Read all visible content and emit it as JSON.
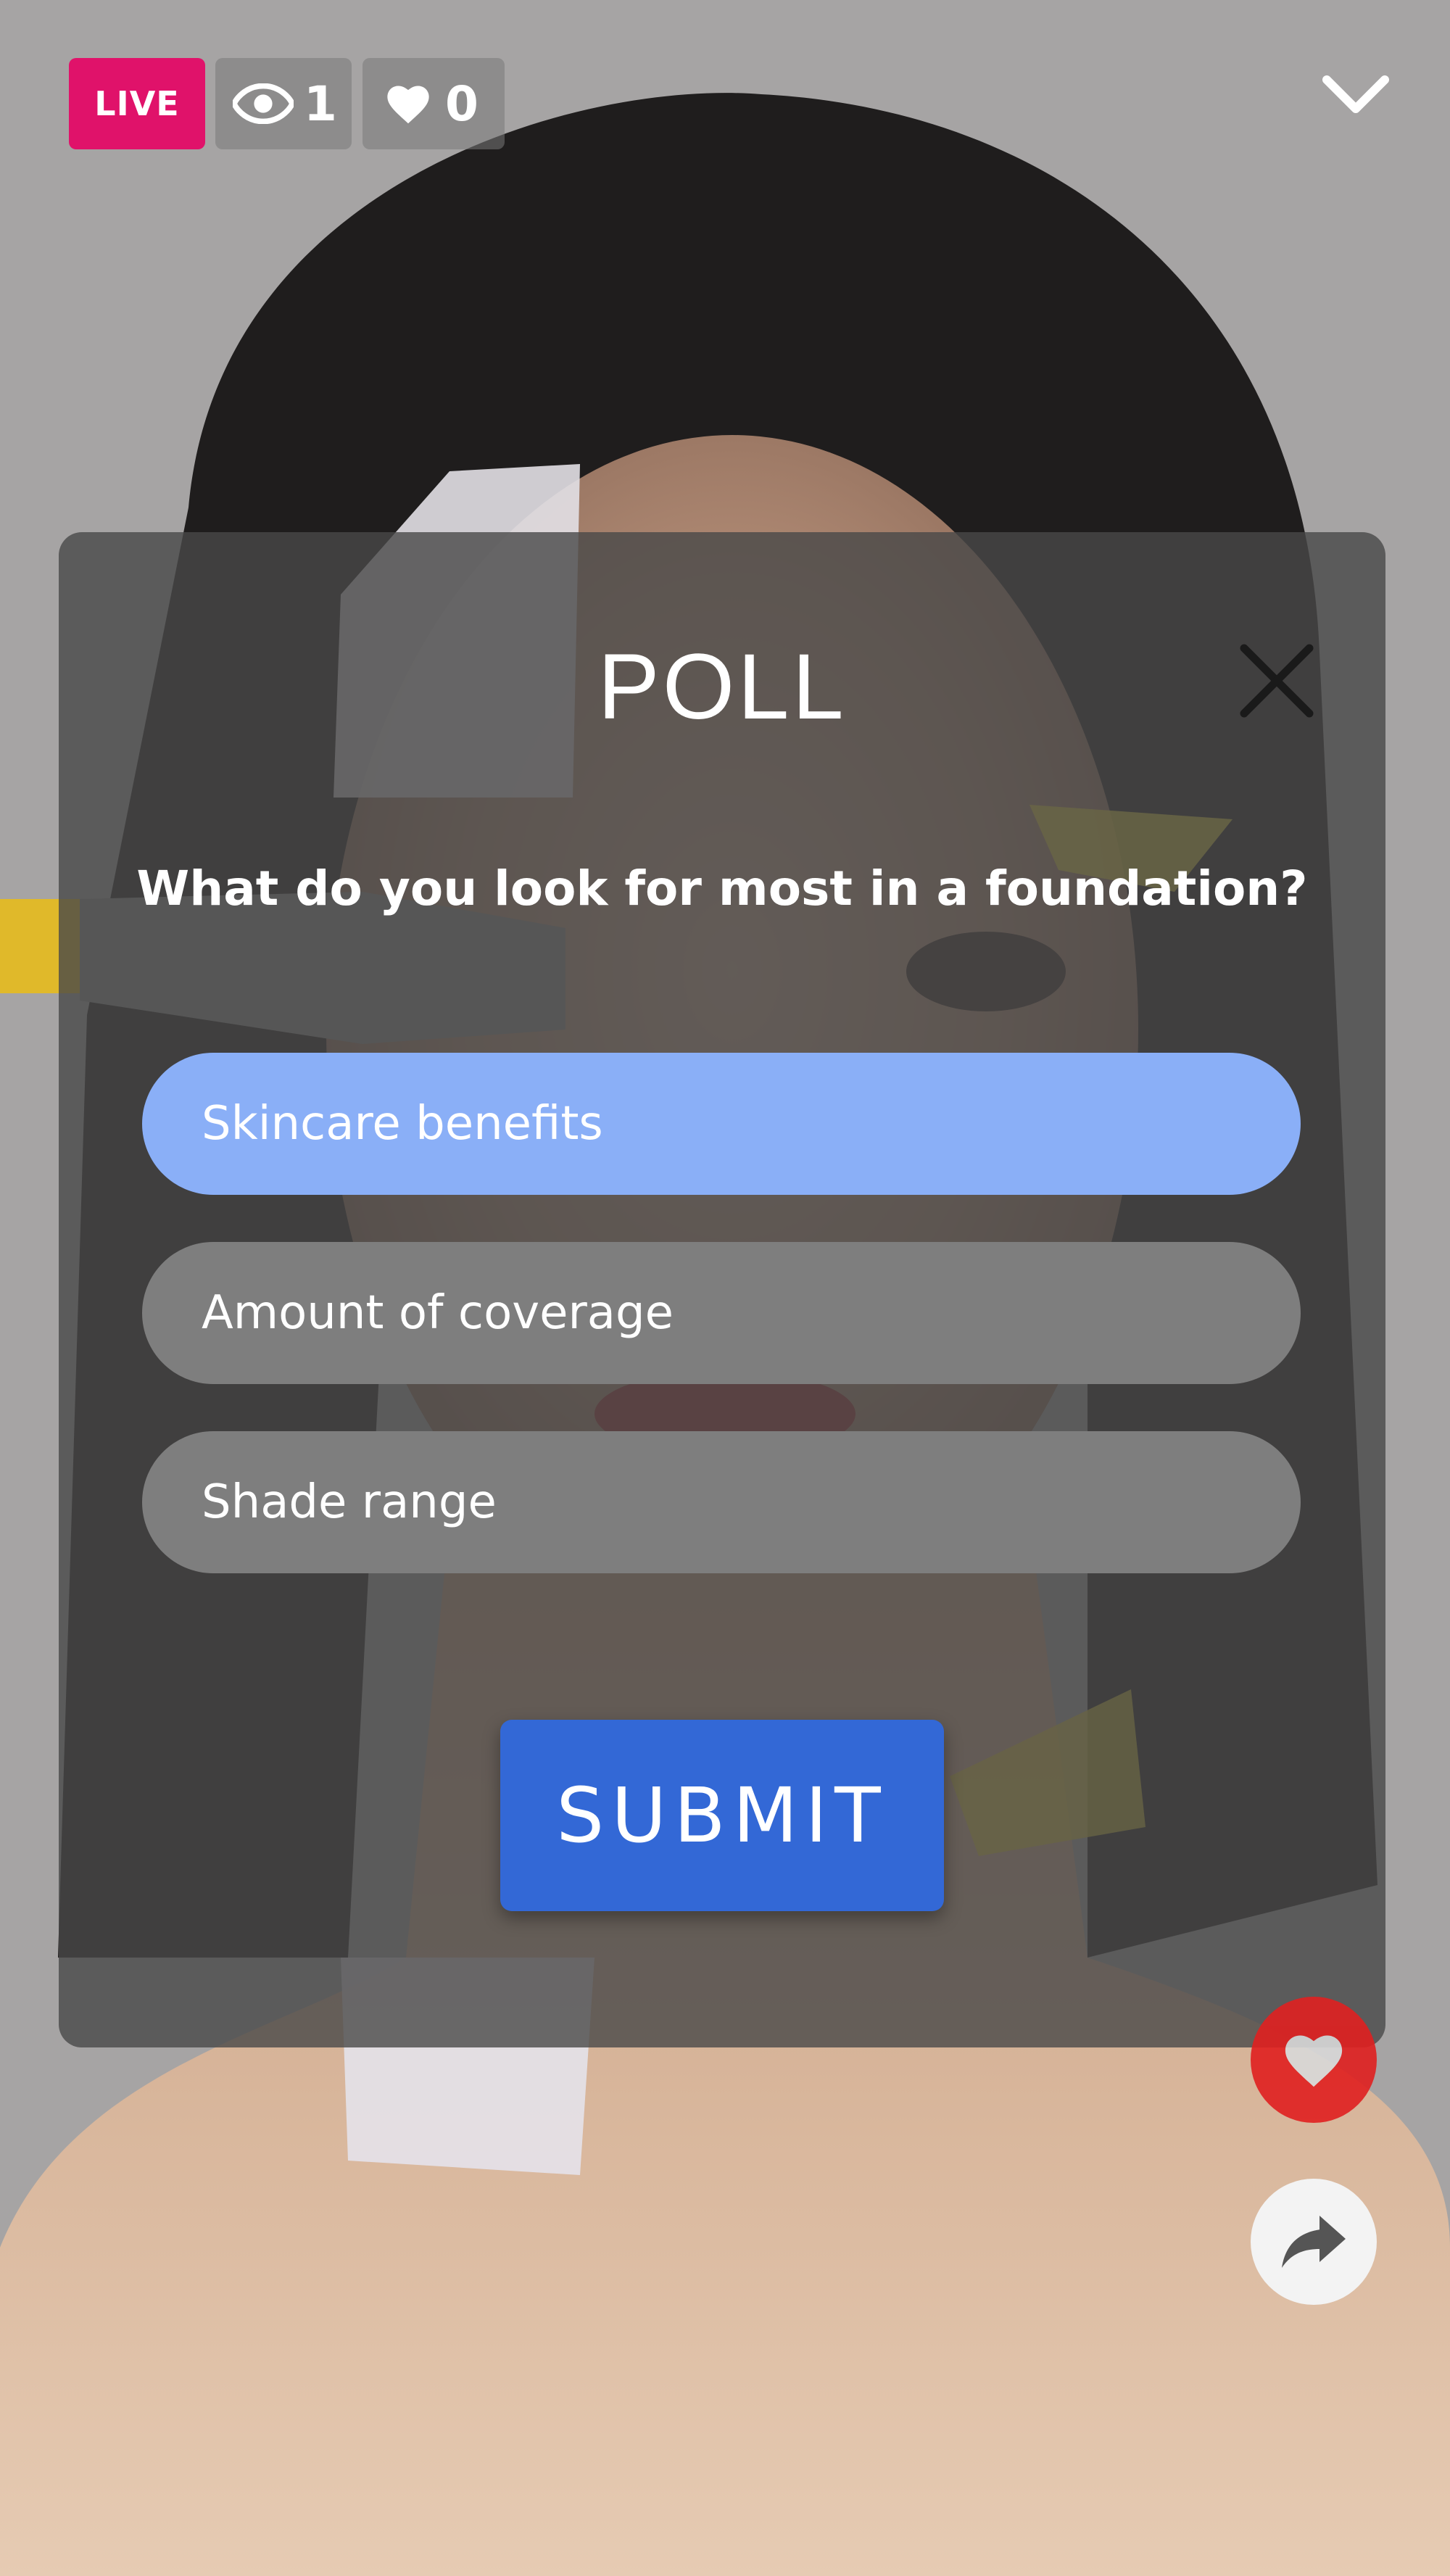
{
  "stream": {
    "live_label": "LIVE",
    "viewer_count": "1",
    "like_count": "0"
  },
  "poll": {
    "title": "POLL",
    "question": "What do you look for most in a foundation?",
    "options": [
      {
        "label": "Skincare benefits",
        "selected": true
      },
      {
        "label": "Amount of coverage",
        "selected": false
      },
      {
        "label": "Shade range",
        "selected": false
      }
    ],
    "submit_label": "SUBMIT"
  },
  "colors": {
    "live_badge": "#e0126a",
    "selected_option": "#8aaff7",
    "option": "#7e7e7e",
    "submit": "#3368d6",
    "like_button": "#e02020"
  },
  "icons": {
    "viewers": "eye-icon",
    "likes": "heart-icon",
    "collapse": "chevron-down-icon",
    "close": "close-icon",
    "like_action": "heart-icon",
    "share_action": "share-arrow-icon"
  }
}
